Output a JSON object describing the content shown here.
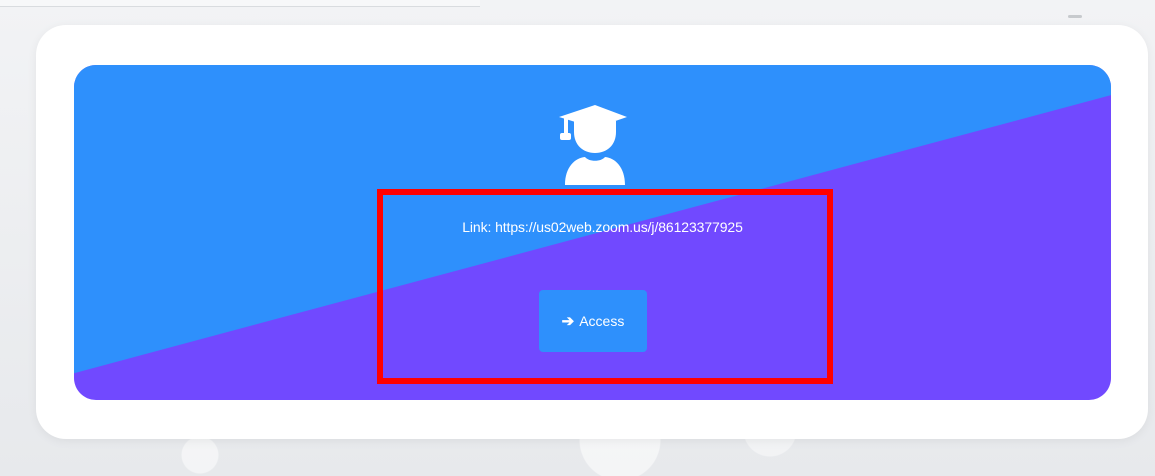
{
  "banner": {
    "icon": "graduate-student-icon",
    "link_text": "Link: https://us02web.zoom.us/j/86123377925",
    "access_button": {
      "icon": "arrow-right-icon",
      "arrow_glyph": "➔",
      "label": "Access"
    }
  },
  "colors": {
    "blue": "#2e90fc",
    "purple": "#7149ff",
    "highlight": "#ff0000"
  }
}
